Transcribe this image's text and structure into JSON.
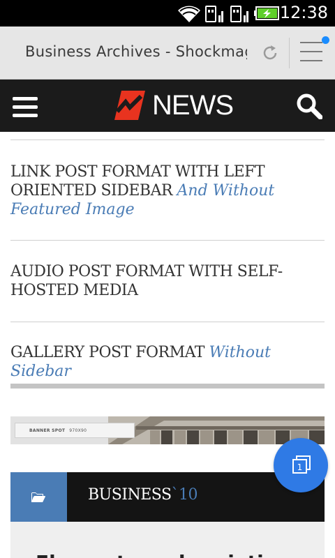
{
  "status_bar": {
    "time": "12:38",
    "icons": [
      "wifi-icon",
      "sim1-icon",
      "sim2-icon",
      "battery-charging-icon"
    ],
    "battery_color": "#5fcf2a"
  },
  "browser": {
    "page_title": "Business Archives - Shockmag",
    "notification_dot_color": "#1a8cff"
  },
  "site_header": {
    "logo_text": "NEWS",
    "logo_accent": "#e8331f"
  },
  "posts": [
    {
      "title": "Link Post Format With Left Oriented Sidebar",
      "subtitle": "And Without Featured Image"
    },
    {
      "title": "Audio Post Format With Self-Hosted Media",
      "subtitle": ""
    },
    {
      "title": "Gallery Post Format",
      "subtitle": "Without Sidebar"
    }
  ],
  "banner": {
    "label": "BANNER SPOT",
    "size": "970X90"
  },
  "category": {
    "name": "BUSINESS",
    "count": "`10",
    "accent": "#4a7cb5"
  },
  "card": {
    "headline": "Elements and variation"
  },
  "fab": {
    "icon": "tabs-switcher-icon",
    "count": "1",
    "color": "#2f7ae5"
  }
}
